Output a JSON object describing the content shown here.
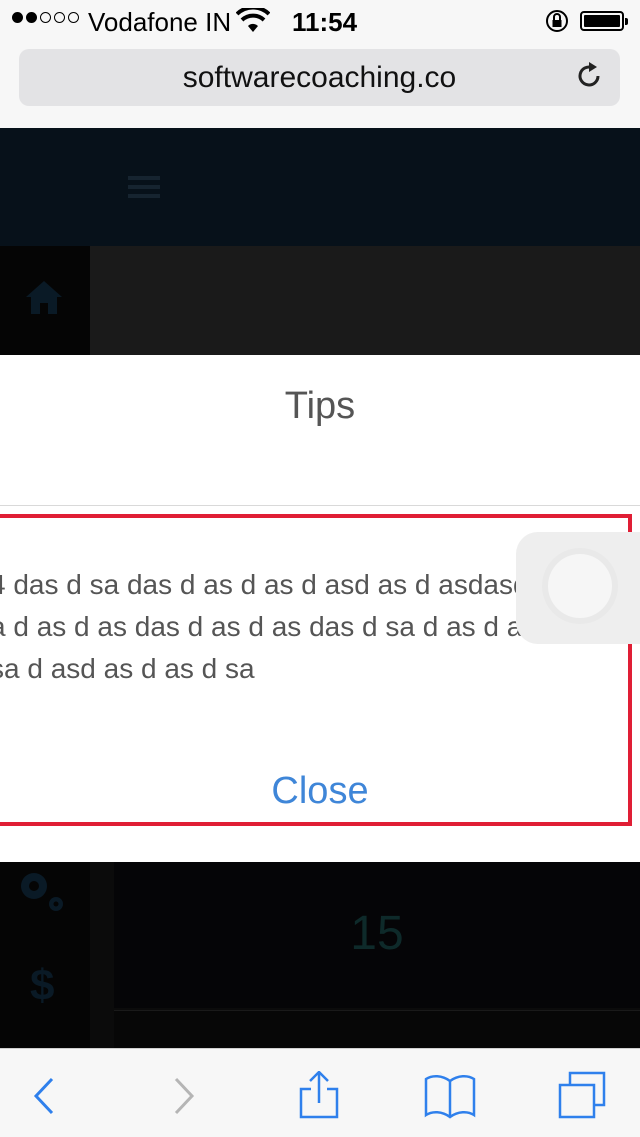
{
  "status_bar": {
    "carrier": "Vodafone IN",
    "time": "11:54",
    "signal_full_dots": 2,
    "signal_total_dots": 5
  },
  "browser": {
    "url": "softwarecoaching.co"
  },
  "page": {
    "counter_value": "15"
  },
  "modal": {
    "title": "Tips",
    "body_lines": [
      "4 das d sa das d as d as d asd as d asdasdsa",
      "a d as d as das d as d as das d sa d as d as d",
      "sa d asd as d as d sa"
    ],
    "close_label": "Close",
    "accent_color": "#3f86d8",
    "highlight_color": "#e01e35"
  },
  "toolbar": {
    "icons": [
      "back-icon",
      "forward-icon",
      "share-icon",
      "bookmarks-icon",
      "tabs-icon"
    ]
  }
}
